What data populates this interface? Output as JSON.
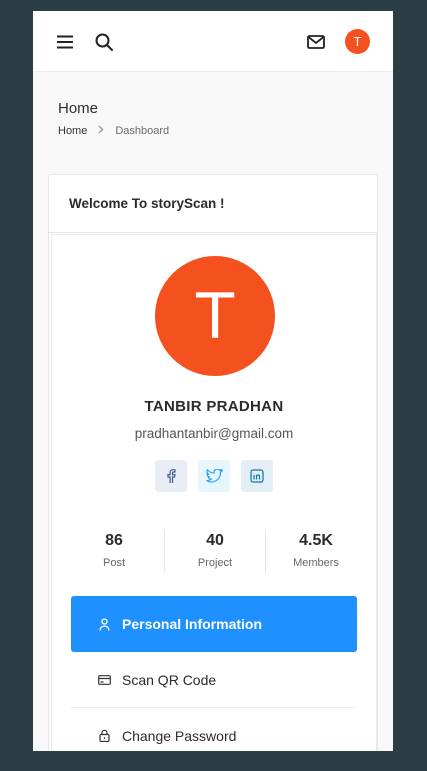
{
  "header": {
    "menu_icon": "hamburger-menu-icon",
    "search_icon": "search-icon",
    "mail_icon": "mail-icon",
    "avatar_initial": "T",
    "avatar_color": "#f4511e"
  },
  "page": {
    "title": "Home",
    "breadcrumb": {
      "home": "Home",
      "separator": ">",
      "current": "Dashboard"
    }
  },
  "card": {
    "title": "Welcome To storyScan !"
  },
  "profile": {
    "avatar_initial": "T",
    "name": "TANBIR PRADHAN",
    "email": "pradhantanbir@gmail.com",
    "socials": [
      "facebook-icon",
      "twitter-icon",
      "linkedin-icon"
    ]
  },
  "stats": [
    {
      "value": "86",
      "label": "Post"
    },
    {
      "value": "40",
      "label": "Project"
    },
    {
      "value": "4.5K",
      "label": "Members"
    }
  ],
  "menu": [
    {
      "label": "Personal Information",
      "icon": "user-icon",
      "active": true
    },
    {
      "label": "Scan QR Code",
      "icon": "credit-card-icon",
      "active": false
    },
    {
      "label": "Change Password",
      "icon": "lock-icon",
      "active": false
    }
  ],
  "colors": {
    "accent": "#1e90ff",
    "brand": "#f4511e",
    "backdrop": "#2c3e45"
  }
}
